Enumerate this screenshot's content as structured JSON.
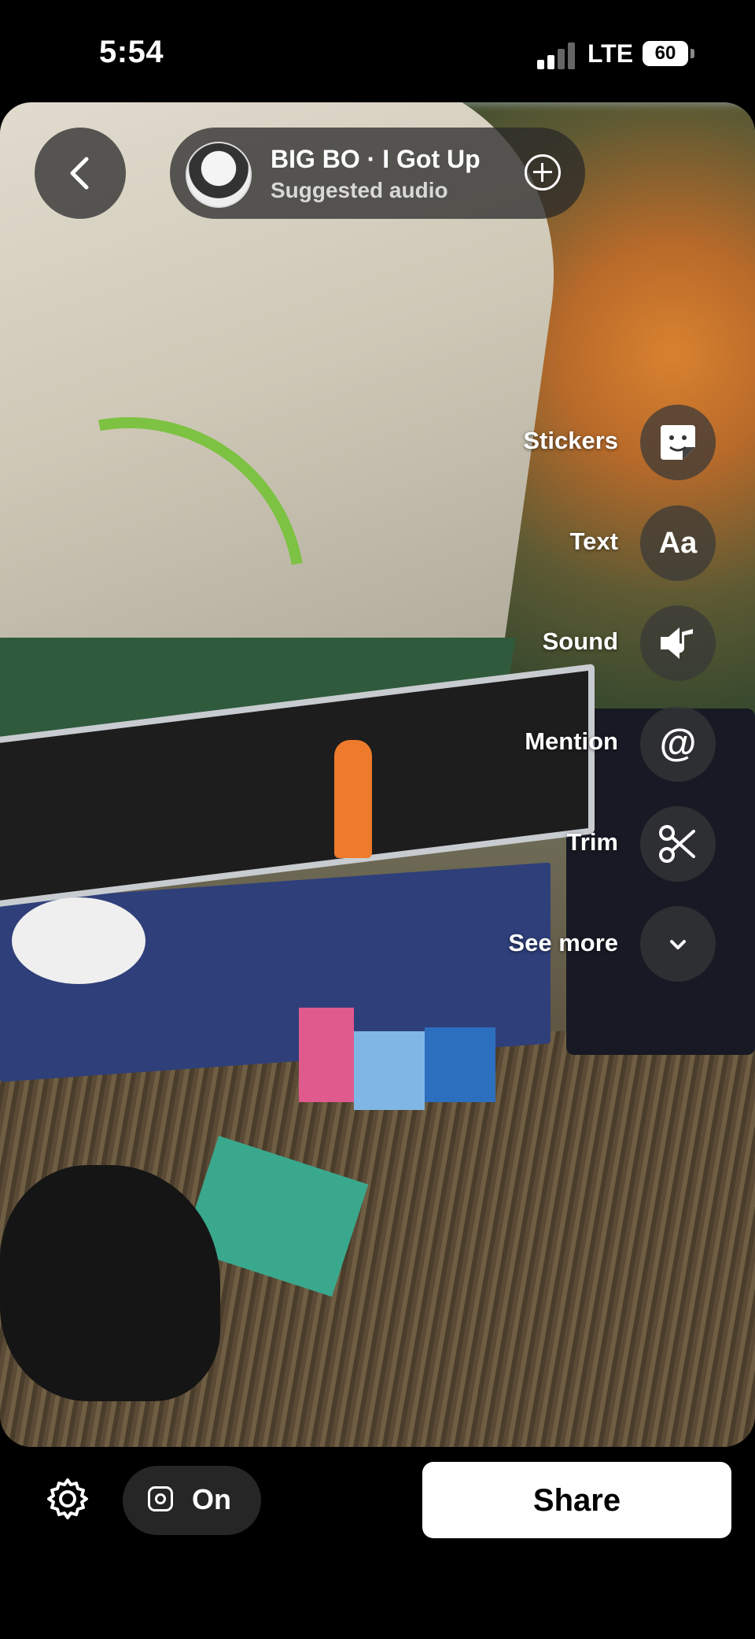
{
  "status_bar": {
    "time": "5:54",
    "network": "LTE",
    "battery": "60"
  },
  "audio": {
    "title": "BIG BO · I Got Up",
    "subtitle": "Suggested audio"
  },
  "tools": [
    {
      "label": "Stickers",
      "icon": "sticker-icon"
    },
    {
      "label": "Text",
      "icon": "text-icon",
      "glyph": "Aa"
    },
    {
      "label": "Sound",
      "icon": "sound-icon"
    },
    {
      "label": "Mention",
      "icon": "mention-icon",
      "glyph": "@"
    },
    {
      "label": "Trim",
      "icon": "scissors-icon"
    },
    {
      "label": "See more",
      "icon": "chevron-down-icon"
    }
  ],
  "bottom_bar": {
    "instagram_toggle": "On",
    "share_label": "Share"
  }
}
